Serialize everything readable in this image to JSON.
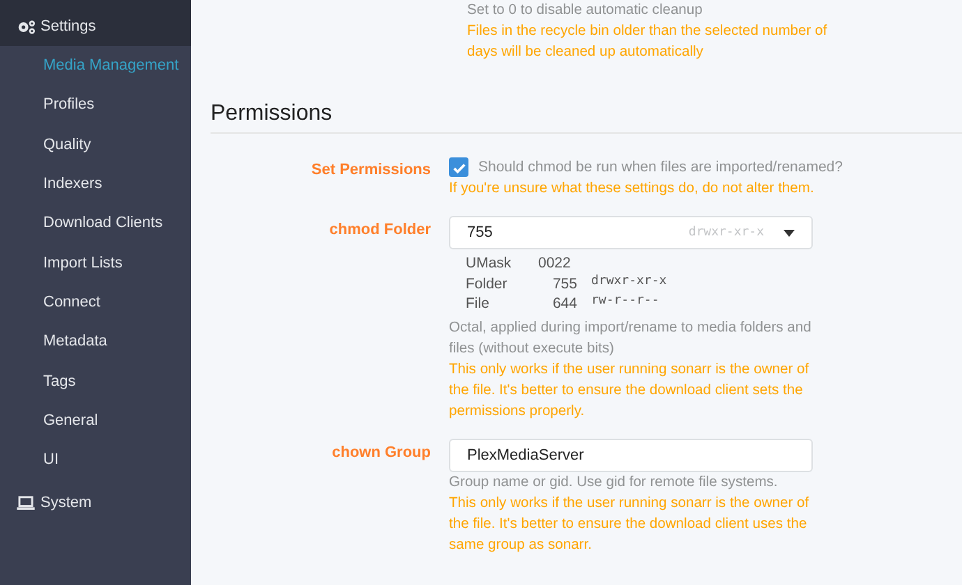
{
  "sidebar": {
    "items": [
      {
        "label": "Settings",
        "selected": true,
        "children": [
          {
            "label": "Media Management",
            "selected": true
          },
          {
            "label": "Profiles",
            "selected": false
          },
          {
            "label": "Quality",
            "selected": false
          },
          {
            "label": "Indexers",
            "selected": false
          },
          {
            "label": "Download Clients",
            "selected": false
          },
          {
            "label": "Import Lists",
            "selected": false
          },
          {
            "label": "Connect",
            "selected": false
          },
          {
            "label": "Metadata",
            "selected": false
          },
          {
            "label": "Tags",
            "selected": false
          },
          {
            "label": "General",
            "selected": false
          },
          {
            "label": "UI",
            "selected": false
          }
        ]
      },
      {
        "label": "System",
        "selected": false
      }
    ]
  },
  "top_hints": [
    {
      "kind": "info",
      "text": "Set to 0 to disable automatic cleanup"
    },
    {
      "kind": "warning",
      "text": "Files in the recycle bin older than the selected number of days will be cleaned up automatically"
    }
  ],
  "section": {
    "title": "Permissions",
    "fields": [
      {
        "kind": "checkbox",
        "label": "Set Permissions",
        "checked": true,
        "check_label": "Should chmod be run when files are imported/renamed?",
        "hints": [
          {
            "kind": "warning",
            "text": "If you're unsure what these settings do, do not alter them."
          }
        ]
      },
      {
        "kind": "select",
        "label": "chmod Folder",
        "value": "755",
        "value_hint": "drwxr-xr-x",
        "umask": [
          {
            "label": "UMask",
            "value": "0022"
          },
          {
            "label": "Folder",
            "value": "755",
            "mode": "drwxr-xr-x"
          },
          {
            "label": "File",
            "value": "644",
            "mode": "rw-r--r--"
          }
        ],
        "hints": [
          {
            "kind": "info",
            "text": "Octal, applied during import/rename to media folders and files (without execute bits)"
          },
          {
            "kind": "warning",
            "text": "This only works if the user running sonarr is the owner of the file. It's better to ensure the download client sets the permissions properly."
          }
        ]
      },
      {
        "kind": "text",
        "label": "chown Group",
        "value": "PlexMediaServer",
        "hints": [
          {
            "kind": "info",
            "text": "Group name or gid. Use gid for remote file systems."
          },
          {
            "kind": "warning",
            "text": "This only works if the user running sonarr is the owner of the file. It's better to ensure the download client uses the same group as sonarr."
          }
        ]
      }
    ]
  }
}
